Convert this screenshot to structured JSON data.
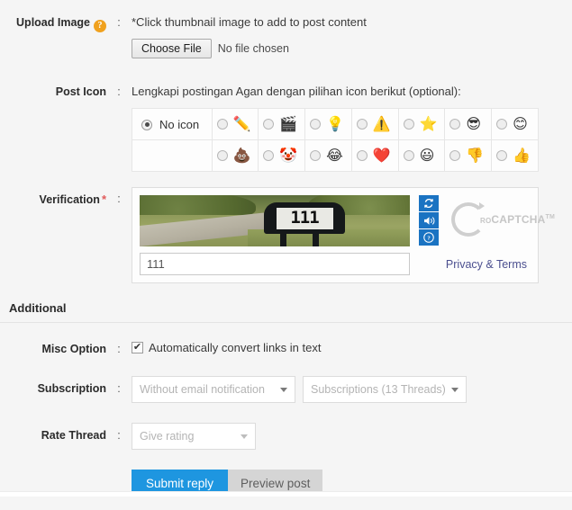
{
  "upload": {
    "label": "Upload Image",
    "help_icon": "question-mark-help-icon",
    "colon": ":",
    "hint": "*Click thumbnail image to add to post content",
    "choose_file_label": "Choose File",
    "no_file_text": "No file chosen"
  },
  "post_icon": {
    "label": "Post Icon",
    "colon": ":",
    "hint": "Lengkapi postingan Agan dengan pilihan icon berikut (optional):",
    "no_icon_label": "No icon",
    "selected": "no-icon",
    "row1": [
      {
        "name": "pencil-icon",
        "glyph": "✏️"
      },
      {
        "name": "clapperboard-icon",
        "glyph": "🎬"
      },
      {
        "name": "lightbulb-icon",
        "glyph": "💡"
      },
      {
        "name": "warning-triangle-icon",
        "glyph": "⚠️"
      },
      {
        "name": "star-icon",
        "glyph": "⭐"
      },
      {
        "name": "sunglasses-face-icon",
        "glyph": "😎"
      },
      {
        "name": "smiley-face-icon",
        "glyph": "😊"
      }
    ],
    "row2": [
      {
        "name": "poop-icon",
        "glyph": "💩"
      },
      {
        "name": "clown-face-icon",
        "glyph": "🤡"
      },
      {
        "name": "laughing-face-icon",
        "glyph": "😂"
      },
      {
        "name": "heart-icon",
        "glyph": "❤️"
      },
      {
        "name": "blue-smiley-icon",
        "glyph": "😃"
      },
      {
        "name": "thumbs-down-icon",
        "glyph": "👎"
      },
      {
        "name": "thumbs-up-icon",
        "glyph": "👍"
      }
    ]
  },
  "verification": {
    "label": "Verification",
    "required_mark": "*",
    "colon": ":",
    "captcha_text": "111",
    "input_value": "111",
    "refresh_icon": "refresh-icon",
    "audio_icon": "audio-speaker-icon",
    "help_icon": "question-mark-icon",
    "brand_ro": "RO",
    "brand_name": "CAPTCHA",
    "brand_tm": "TM",
    "privacy_link": "Privacy & Terms"
  },
  "additional": {
    "section_title": "Additional",
    "misc": {
      "label": "Misc Option",
      "colon": ":",
      "checked": true,
      "checkbox_glyph": "✔",
      "option_text": "Automatically convert links in text"
    },
    "subscription": {
      "label": "Subscription",
      "colon": ":",
      "select1_value": "Without email notification",
      "select2_value": "Subscriptions (13 Threads)"
    },
    "rate_thread": {
      "label": "Rate Thread",
      "colon": ":",
      "select_value": "Give rating"
    }
  },
  "actions": {
    "submit_label": "Submit reply",
    "preview_label": "Preview post"
  },
  "colors": {
    "page_bg": "#f5f5f5",
    "submit_blue": "#1e96e0",
    "preview_grey": "#d5d5d5",
    "help_orange": "#f0a11e",
    "required_red": "#e05a5a",
    "link_purple": "#4b4f8f",
    "captcha_btn_blue": "#1a73c2"
  }
}
